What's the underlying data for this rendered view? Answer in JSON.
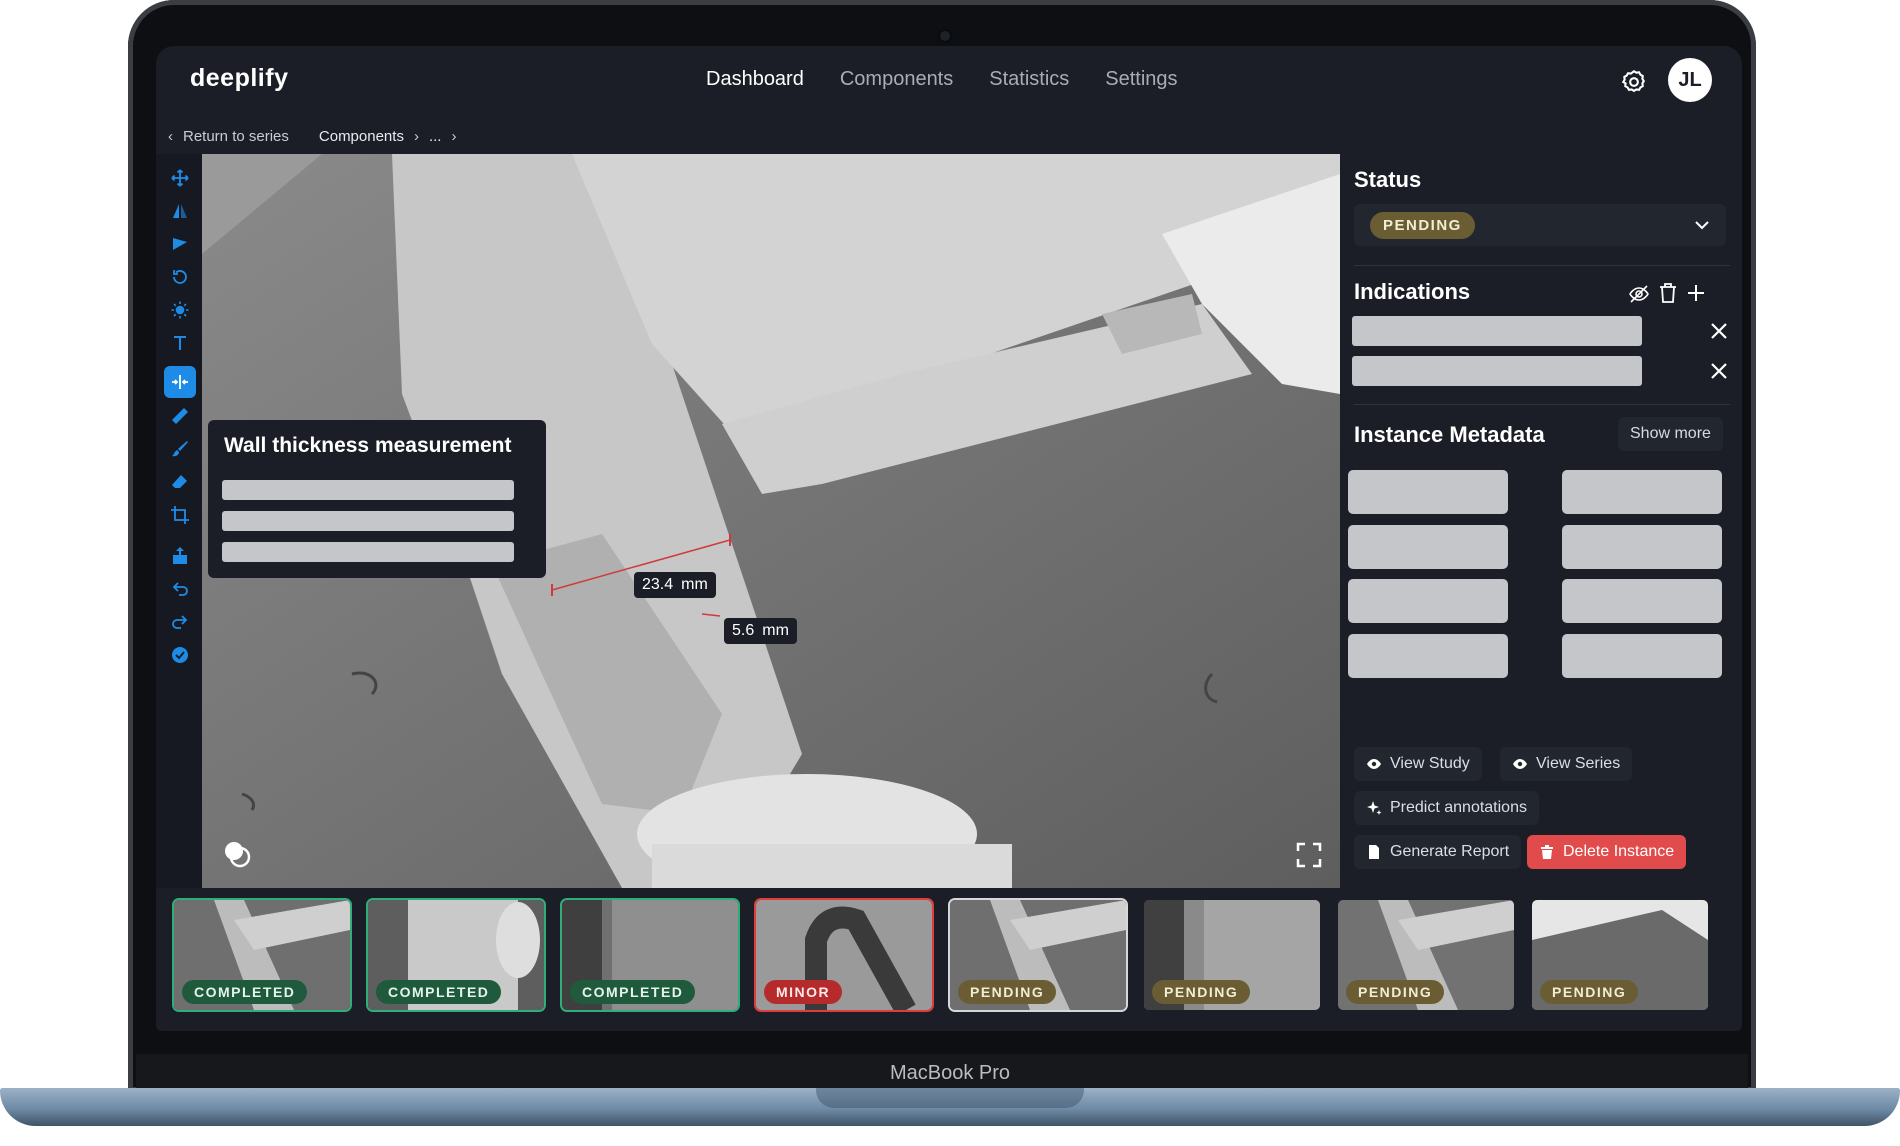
{
  "device": {
    "label": "MacBook Pro"
  },
  "app": {
    "logo": "deeplify",
    "nav": [
      "Dashboard",
      "Components",
      "Statistics",
      "Settings"
    ],
    "active_nav": "Dashboard",
    "user_initials": "JL"
  },
  "breadcrumb": {
    "back": "Return to series",
    "components": "Components",
    "ellipsis": "..."
  },
  "toolbar_icons": [
    "pan-icon",
    "flip-icon",
    "annotate-icon",
    "rotate-icon",
    "brightness-icon",
    "text-icon",
    "wall-thickness-icon",
    "ruler-icon",
    "brush-icon",
    "eraser-icon",
    "crop-icon",
    "export-icon",
    "undo-icon",
    "redo-icon",
    "confirm-icon"
  ],
  "viewer": {
    "panel_title": "Wall thickness measurement",
    "measurement_1": {
      "value": "23.4",
      "unit": "mm"
    },
    "measurement_2": {
      "value": "5.6",
      "unit": "mm"
    }
  },
  "sidebar": {
    "status_title": "Status",
    "status_value": "PENDING",
    "indications_title": "Indications",
    "metadata_title": "Instance Metadata",
    "show_more": "Show more",
    "actions": {
      "view_study": "View Study",
      "view_series": "View Series",
      "predict": "Predict annotations",
      "report": "Generate Report",
      "delete": "Delete Instance"
    }
  },
  "filmstrip": [
    {
      "status": "COMPLETED"
    },
    {
      "status": "COMPLETED"
    },
    {
      "status": "COMPLETED"
    },
    {
      "status": "MINOR"
    },
    {
      "status": "PENDING"
    },
    {
      "status": "PENDING"
    },
    {
      "status": "PENDING"
    },
    {
      "status": "PENDING"
    }
  ],
  "colors": {
    "accent": "#1e8ce6",
    "danger": "#e24b4b",
    "completed": "#2fae78",
    "pending_badge": "#6a5d33"
  }
}
